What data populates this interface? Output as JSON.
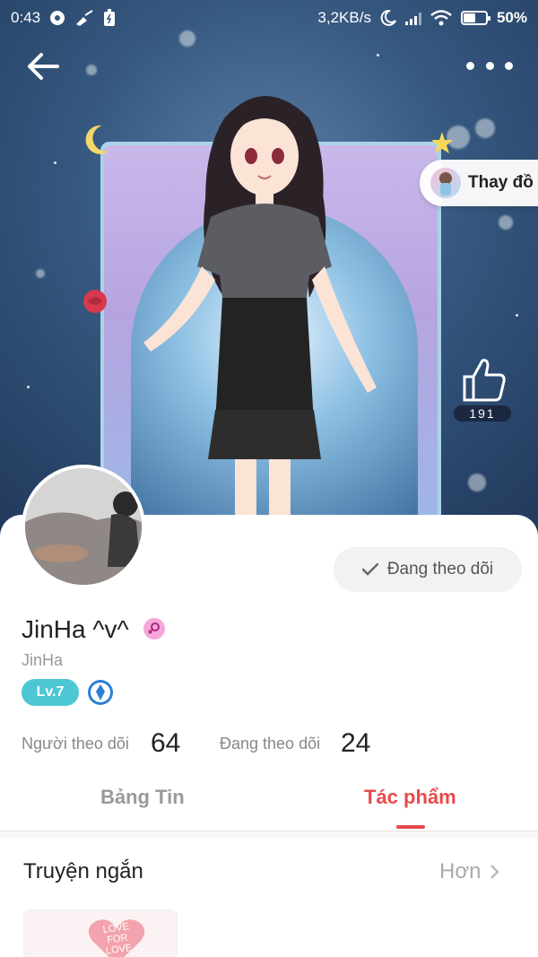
{
  "status_bar": {
    "time": "0:43",
    "network_speed": "3,2KB/s",
    "battery": "50%",
    "icons": [
      "music-icon",
      "broom-icon",
      "battery-saver-icon",
      "moon-icon",
      "signal-icon",
      "wifi-icon",
      "battery-icon"
    ]
  },
  "header": {
    "back_icon": "arrow-left-icon",
    "more_icon": "more-dots-icon"
  },
  "hero": {
    "outfit_button_label": "Thay đồ",
    "like_count": "191",
    "like_icon": "thumbs-up-icon"
  },
  "profile": {
    "display_name": "JinHa ^v^",
    "username": "JinHa",
    "level": "Lv.7",
    "follow_status": "Đang theo dõi",
    "followers_label": "Người theo dõi",
    "followers_count": "64",
    "following_label": "Đang theo dõi",
    "following_count": "24"
  },
  "tabs": [
    {
      "label": "Bảng Tin",
      "active": false
    },
    {
      "label": "Tác phẩm",
      "active": true
    }
  ],
  "section": {
    "title": "Truyện ngắn",
    "more_label": "Hơn"
  },
  "story_card": {
    "cover_text": "LOVE FOR LOVE"
  },
  "colors": {
    "accent": "#e84a4a",
    "level_badge": "#4cc7d3",
    "gender_badge": "#f5a8d8"
  }
}
